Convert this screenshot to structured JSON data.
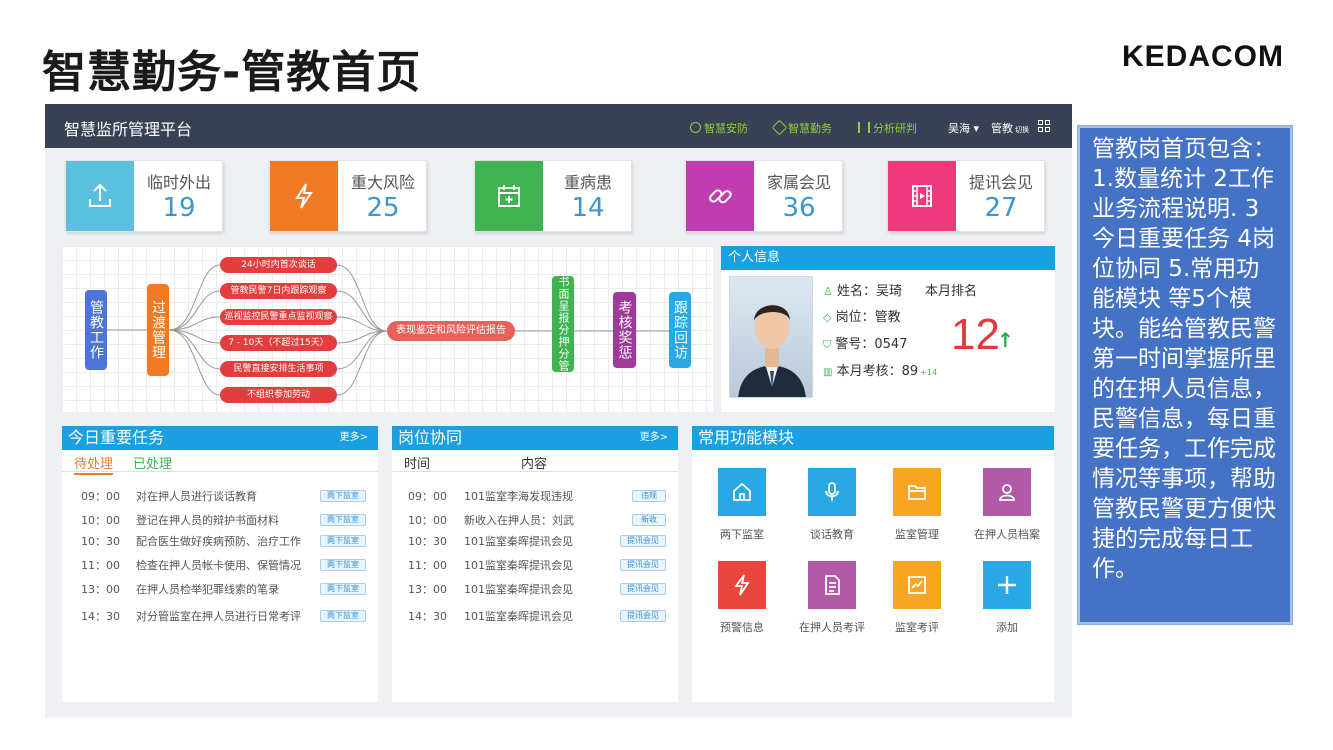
{
  "slide": {
    "title": "智慧勤务-管教首页",
    "brand": "KEDACOM"
  },
  "topbar": {
    "platform": "智慧监所管理平台",
    "nav": [
      "智慧安防",
      "智慧勤务",
      "分析研判"
    ],
    "user_name": "吴海",
    "role": "管教",
    "role_extra": "切换"
  },
  "stats": [
    {
      "label": "临时外出",
      "value": "19",
      "color": "#5bc0de",
      "icon": "upload-icon"
    },
    {
      "label": "重大风险",
      "value": "25",
      "color": "#f07b24",
      "icon": "lightning-icon"
    },
    {
      "label": "重病患",
      "value": "14",
      "color": "#3fb34f",
      "icon": "medical-calendar-icon"
    },
    {
      "label": "家属会见",
      "value": "36",
      "color": "#c03cb0",
      "icon": "link-icon"
    },
    {
      "label": "提讯会见",
      "value": "27",
      "color": "#ee3a7c",
      "icon": "film-icon"
    }
  ],
  "flow": {
    "start": "管教工作",
    "transition": "过渡管理",
    "steps": [
      "24小时内首次谈话",
      "管教民警7日内跟踪观察",
      "巡视监控民警重点监视观察",
      "7 - 10天（不超过15天）",
      "民警直接安排生活事项",
      "不组织参加劳动"
    ],
    "report": "表现鉴定和风险评估报告",
    "end_nodes": [
      "书面呈报分押分管",
      "考核奖惩",
      "跟踪回访"
    ]
  },
  "personal": {
    "title": "个人信息",
    "name_label": "姓名：吴琦",
    "rank_label": "本月排名",
    "post_label": "岗位：管教",
    "badge_label": "警号：0547",
    "score_label": "本月考核：",
    "score": "89",
    "score_delta": "+14",
    "rank": "12",
    "rank_arrow": "↑"
  },
  "tasks": {
    "title": "今日重要任务",
    "more": "更多>",
    "tabs": [
      "待处理",
      "已处理"
    ],
    "rows": [
      {
        "time": "09：00",
        "text": "对在押人员进行谈话教育",
        "tag": "两下监室"
      },
      {
        "time": "10：00",
        "text": "登记在押人员的辩护书面材料",
        "tag": "两下监室"
      },
      {
        "time": "10：30",
        "text": "配合医生做好疾病预防、治疗工作",
        "tag": "两下监室"
      },
      {
        "time": "11：00",
        "text": "检查在押人员帐卡使用、保管情况",
        "tag": "两下监室"
      },
      {
        "time": "13：00",
        "text": "在押人员检举犯罪线索的笔录",
        "tag": "两下监室"
      },
      {
        "time": "14：30",
        "text": "对分管监室在押人员进行日常考评",
        "tag": "两下监室"
      }
    ]
  },
  "collab": {
    "title": "岗位协同",
    "more": "更多>",
    "col_time": "时间",
    "col_content": "内容",
    "rows": [
      {
        "time": "09：00",
        "text": "101监室李海发现违规",
        "tag": "违规"
      },
      {
        "time": "10：00",
        "text": "新收入在押人员：刘武",
        "tag": "新收"
      },
      {
        "time": "10：30",
        "text": "101监室秦晖提讯会见",
        "tag": "提讯会见"
      },
      {
        "time": "11：00",
        "text": "101监室秦晖提讯会见",
        "tag": "提讯会见"
      },
      {
        "time": "13：00",
        "text": "101监室秦晖提讯会见",
        "tag": "提讯会见"
      },
      {
        "time": "14：30",
        "text": "101监室秦晖提讯会见",
        "tag": "提讯会见"
      }
    ]
  },
  "modules": {
    "title": "常用功能模块",
    "items": [
      {
        "label": "两下监室",
        "color": "#2aa8e6",
        "icon": "home-icon"
      },
      {
        "label": "谈话教育",
        "color": "#2aa8e6",
        "icon": "microphone-icon"
      },
      {
        "label": "监室管理",
        "color": "#f6a623",
        "icon": "folder-icon"
      },
      {
        "label": "在押人员档案",
        "color": "#b15aa8",
        "icon": "person-icon"
      },
      {
        "label": "预警信息",
        "color": "#e8453c",
        "icon": "lightning-icon"
      },
      {
        "label": "在押人员考评",
        "color": "#b15aa8",
        "icon": "document-icon"
      },
      {
        "label": "监室考评",
        "color": "#f6a623",
        "icon": "chart-icon"
      },
      {
        "label": "添加",
        "color": "#2aa8e6",
        "icon": "plus-icon"
      }
    ]
  },
  "note": {
    "text": "管教岗首页包含：1.数量统计 2工作业务流程说明. 3今日重要任务 4岗位协同  5.常用功能模块  等5个模块。能给管教民警第一时间掌握所里的在押人员信息，民警信息，每日重要任务，工作完成情况等事项，帮助管教民警更方便快捷的完成每日工作。"
  }
}
